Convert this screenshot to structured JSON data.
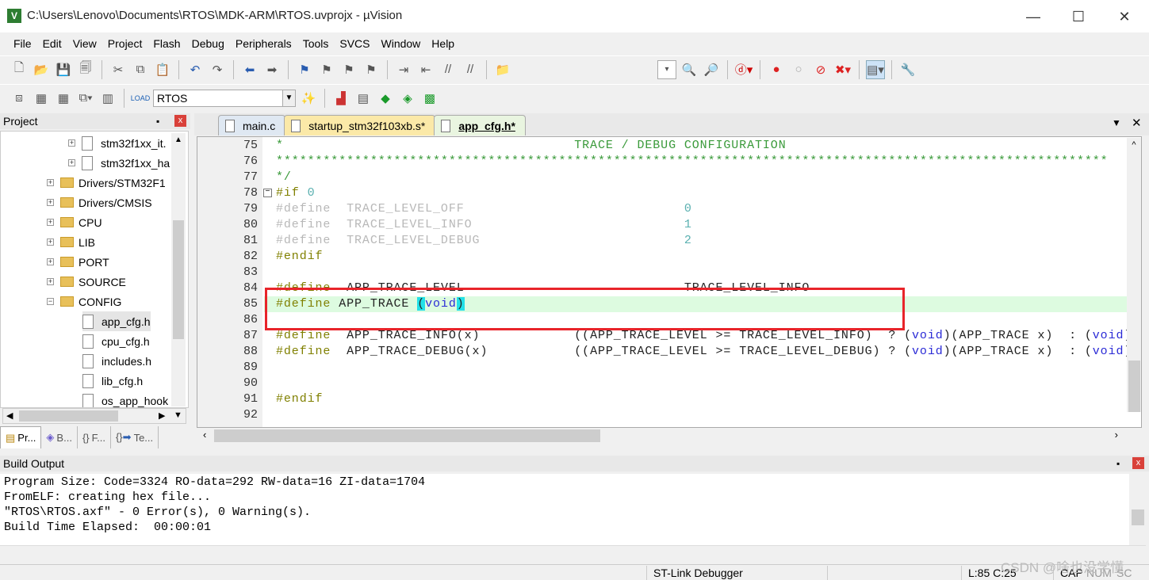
{
  "window": {
    "title": "C:\\Users\\Lenovo\\Documents\\RTOS\\MDK-ARM\\RTOS.uvprojx - µVision",
    "minimize": "—",
    "maximize": "☐",
    "close": "✕"
  },
  "menu": [
    "File",
    "Edit",
    "View",
    "Project",
    "Flash",
    "Debug",
    "Peripherals",
    "Tools",
    "SVCS",
    "Window",
    "Help"
  ],
  "toolbar2": {
    "target": "RTOS"
  },
  "project": {
    "title": "Project",
    "pin": "📌",
    "close": "x",
    "tree": [
      {
        "label": "stm32f1xx_it.",
        "type": "file",
        "expand": "+"
      },
      {
        "label": "stm32f1xx_ha",
        "type": "file",
        "expand": "+"
      },
      {
        "label": "Drivers/STM32F1",
        "type": "folder",
        "expand": "+"
      },
      {
        "label": "Drivers/CMSIS",
        "type": "folder",
        "expand": "+"
      },
      {
        "label": "CPU",
        "type": "folder",
        "expand": "+"
      },
      {
        "label": "LIB",
        "type": "folder",
        "expand": "+"
      },
      {
        "label": "PORT",
        "type": "folder",
        "expand": "+"
      },
      {
        "label": "SOURCE",
        "type": "folder",
        "expand": "+"
      },
      {
        "label": "CONFIG",
        "type": "folder",
        "expand": "−"
      },
      {
        "label": "app_cfg.h",
        "type": "file",
        "selected": true
      },
      {
        "label": "cpu_cfg.h",
        "type": "file"
      },
      {
        "label": "includes.h",
        "type": "file"
      },
      {
        "label": "lib_cfg.h",
        "type": "file"
      },
      {
        "label": "os_app_hook",
        "type": "file"
      }
    ],
    "tabs": [
      "Pr...",
      "B...",
      "F...",
      "Te..."
    ]
  },
  "editor": {
    "tabs": [
      {
        "label": "main.c"
      },
      {
        "label": "startup_stm32f103xb.s*",
        "modified": true
      },
      {
        "label": "app_cfg.h*",
        "active": true
      }
    ],
    "current_line": 85,
    "lines": [
      {
        "n": "75",
        "parts": [
          [
            "cmt",
            "*                                     TRACE / DEBUG CONFIGURATION"
          ]
        ]
      },
      {
        "n": "76",
        "parts": [
          [
            "cmt",
            "**********************************************************************************************************"
          ]
        ]
      },
      {
        "n": "77",
        "parts": [
          [
            "cmt",
            "*/"
          ]
        ]
      },
      {
        "n": "78",
        "fold": "−",
        "parts": [
          [
            "pp",
            "#if "
          ],
          [
            "num",
            "0"
          ]
        ]
      },
      {
        "n": "79",
        "parts": [
          [
            "inact",
            "#define  TRACE_LEVEL_OFF                            "
          ],
          [
            "num",
            "0"
          ]
        ]
      },
      {
        "n": "80",
        "parts": [
          [
            "inact",
            "#define  TRACE_LEVEL_INFO                           "
          ],
          [
            "num",
            "1"
          ]
        ]
      },
      {
        "n": "81",
        "parts": [
          [
            "inact",
            "#define  TRACE_LEVEL_DEBUG                          "
          ],
          [
            "num",
            "2"
          ]
        ]
      },
      {
        "n": "82",
        "parts": [
          [
            "pp",
            "#endif"
          ]
        ]
      },
      {
        "n": "83",
        "parts": []
      },
      {
        "n": "84",
        "parts": [
          [
            "pp",
            "#define  "
          ],
          [
            "txt",
            "APP_TRACE_LEVEL                            TRACE_LEVEL_INFO"
          ]
        ]
      },
      {
        "n": "85",
        "parts": [
          [
            "pp",
            "#define "
          ],
          [
            "txt",
            "APP_TRACE "
          ],
          [
            "brace txt",
            "("
          ],
          [
            "kw",
            "void"
          ],
          [
            "brace txt",
            ")"
          ]
        ]
      },
      {
        "n": "86",
        "parts": []
      },
      {
        "n": "87",
        "parts": [
          [
            "pp",
            "#define  "
          ],
          [
            "txt",
            "APP_TRACE_INFO(x)            ((APP_TRACE_LEVEL >= TRACE_LEVEL_INFO)  ? ("
          ],
          [
            "kw",
            "void"
          ],
          [
            "txt",
            ")(APP_TRACE x)  : ("
          ],
          [
            "kw",
            "void"
          ],
          [
            "txt",
            ")"
          ]
        ]
      },
      {
        "n": "88",
        "parts": [
          [
            "pp",
            "#define  "
          ],
          [
            "txt",
            "APP_TRACE_DEBUG(x)           ((APP_TRACE_LEVEL >= TRACE_LEVEL_DEBUG) ? ("
          ],
          [
            "kw",
            "void"
          ],
          [
            "txt",
            ")(APP_TRACE x)  : ("
          ],
          [
            "kw",
            "void"
          ],
          [
            "txt",
            ")"
          ]
        ]
      },
      {
        "n": "89",
        "parts": []
      },
      {
        "n": "90",
        "parts": []
      },
      {
        "n": "91",
        "parts": [
          [
            "pp",
            "#endif"
          ]
        ]
      },
      {
        "n": "92",
        "parts": []
      }
    ]
  },
  "build": {
    "title": "Build Output",
    "lines": [
      "Program Size: Code=3324 RO-data=292 RW-data=16 ZI-data=1704",
      "FromELF: creating hex file...",
      "\"RTOS\\RTOS.axf\" - 0 Error(s), 0 Warning(s).",
      "Build Time Elapsed:  00:00:01"
    ]
  },
  "status": {
    "debugger": "ST-Link Debugger",
    "position": "L:85 C:25",
    "caps": "CAP",
    "num": "NUM",
    "scroll": "SC"
  },
  "watermark": "CSDN @啥也没学懂"
}
